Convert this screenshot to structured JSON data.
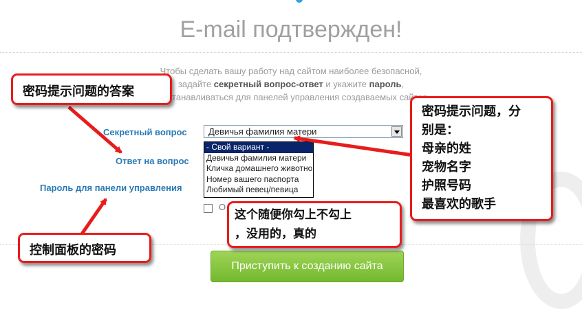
{
  "page": {
    "title": "E-mail подтвержден!",
    "intro": {
      "line1": "Чтобы сделать вашу работу над сайтом наиболее безопасной,",
      "line2_pre": "задайте ",
      "line2_b1": "секретный вопрос-ответ",
      "line2_mid": " и укажите ",
      "line2_b2": "пароль",
      "line2_post": ",",
      "line3": "ет устанавливаться для панелей управления создаваемых сайтов."
    }
  },
  "form": {
    "secret_question_label": "Секретный вопрос",
    "answer_label": "Ответ на вопрос",
    "password_label": "Пароль для панели управления",
    "select_value": "Девичья фамилия матери",
    "options": [
      "- Свой вариант -",
      "Девичья фамилия матери",
      "Кличка домашнего животного",
      "Номер вашего паспорта",
      "Любимый певец/певица"
    ],
    "checkbox_label": "О",
    "submit_label": "Приступить к созданию сайта"
  },
  "annotations": {
    "secret_question_note": "密码提示问题的答案",
    "questions_list": [
      "密码提示问题，分",
      "别是：",
      "母亲的姓",
      "宠物名字",
      "护照号码",
      "最喜欢的歌手"
    ],
    "checkbox_note": [
      "这个随便你勾上不勾上",
      "，没用的，真的"
    ],
    "password_note": "控制面板的密码"
  },
  "colors": {
    "label_blue": "#2a7ab5",
    "callout_border": "#e81c1c",
    "button_green": "#8ac843",
    "selected_option": "#0a246a"
  }
}
